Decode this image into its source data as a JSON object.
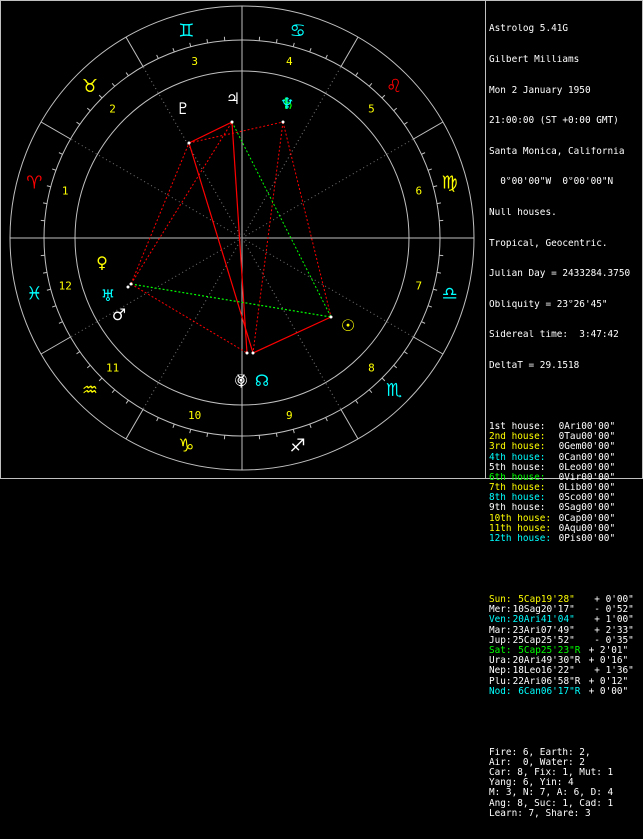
{
  "colors": {
    "background": "#000000",
    "circle": "#c0c0c0",
    "house_line": "#808080",
    "sign_fire": "#ff0000",
    "sign_earth": "#ffff00",
    "sign_air": "#00ffff",
    "sign_water": "#00ffff",
    "aspect_square": "#ff0000",
    "aspect_trine": "#00ff00",
    "house_number": "#ffff00"
  },
  "header": {
    "program": "Astrolog 5.41G",
    "name": "Gilbert Milliams",
    "date": "Mon 2 January 1950",
    "time": "21:00:00 (ST +0:00 GMT)",
    "place": "Santa Monica, California",
    "coords": "  0°00'00\"W  0°00'00\"N",
    "houses": "Null houses.",
    "zodiac": "Tropical, Geocentric.",
    "julian": "Julian Day = 2433284.3750",
    "obliquity": "Obliquity = 23°26'45\"",
    "sidereal": "Sidereal time:  3:47:42",
    "deltat": "DeltaT = 29.1518"
  },
  "cusps": [
    {
      "house": "1st house:",
      "pos": " 0Ari00'00\"",
      "color": "#ffffff"
    },
    {
      "house": "2nd house:",
      "pos": " 0Tau00'00\"",
      "color": "#ffff00"
    },
    {
      "house": "3rd house:",
      "pos": " 0Gem00'00\"",
      "color": "#ffff00"
    },
    {
      "house": "4th house:",
      "pos": " 0Can00'00\"",
      "color": "#00ffff"
    },
    {
      "house": "5th house:",
      "pos": " 0Leo00'00\"",
      "color": "#ffffff"
    },
    {
      "house": "6th house:",
      "pos": " 0Vir00'00\"",
      "color": "#00ff00"
    },
    {
      "house": "7th house:",
      "pos": " 0Lib00'00\"",
      "color": "#ffff00"
    },
    {
      "house": "8th house:",
      "pos": " 0Sco00'00\"",
      "color": "#00ffff"
    },
    {
      "house": "9th house:",
      "pos": " 0Sag00'00\"",
      "color": "#ffffff"
    },
    {
      "house": "10th house:",
      "pos": " 0Cap00'00\"",
      "color": "#ffff00"
    },
    {
      "house": "11th house:",
      "pos": " 0Aqu00'00\"",
      "color": "#ffff00"
    },
    {
      "house": "12th house:",
      "pos": " 0Pis00'00\"",
      "color": "#00ffff"
    }
  ],
  "planets": [
    {
      "name": "Sun:",
      "pos": "  5Cap19'28\"",
      "speed": "  + 0'00\"",
      "color": "#ffff00"
    },
    {
      "name": "Mer:",
      "pos": " 10Sag20'17\"",
      "speed": "  - 0'52\"",
      "color": "#ffffff"
    },
    {
      "name": "Ven:",
      "pos": " 20Ari41'04\"",
      "speed": "  + 1'00\"",
      "color": "#00ffff"
    },
    {
      "name": "Mar:",
      "pos": " 23Ari07'49\"",
      "speed": "  + 2'33\"",
      "color": "#ffffff"
    },
    {
      "name": "Jup:",
      "pos": " 25Cap25'52\"",
      "speed": "  - 0'35\"",
      "color": "#ffffff"
    },
    {
      "name": "Sat:",
      "pos": "  5Cap25'23\"R",
      "speed": " + 2'01\"",
      "color": "#00ff00"
    },
    {
      "name": "Ura:",
      "pos": " 20Ari49'30\"R",
      "speed": " + 0'16\"",
      "color": "#ffffff"
    },
    {
      "name": "Nep:",
      "pos": " 18Leo16'22\"",
      "speed": "  + 1'36\"",
      "color": "#ffffff"
    },
    {
      "name": "Plu:",
      "pos": " 22Ari06'58\"R",
      "speed": " + 0'12\"",
      "color": "#ffffff"
    },
    {
      "name": "Nod:",
      "pos": "  6Can06'17\"R",
      "speed": " + 0'00\"",
      "color": "#00ffff"
    }
  ],
  "summary": [
    "Fire: 6, Earth: 2,",
    "Air:  0, Water: 2",
    "Car: 8, Fix: 1, Mut: 1",
    "Yang: 6, Yin: 4",
    "M: 3, N: 7, A: 6, D: 4",
    "Ang: 8, Suc: 1, Cad: 1",
    "Learn: 7, Share: 3"
  ],
  "wheel": {
    "signs": [
      {
        "name": "aries",
        "glyph": "♈",
        "color": "#ff0000"
      },
      {
        "name": "taurus",
        "glyph": "♉",
        "color": "#ffff00"
      },
      {
        "name": "gemini",
        "glyph": "♊",
        "color": "#00ffff"
      },
      {
        "name": "cancer",
        "glyph": "♋",
        "color": "#00ffff"
      },
      {
        "name": "leo",
        "glyph": "♌",
        "color": "#ff0000"
      },
      {
        "name": "virgo",
        "glyph": "♍",
        "color": "#ffff00"
      },
      {
        "name": "libra",
        "glyph": "♎",
        "color": "#00ffff"
      },
      {
        "name": "scorpio",
        "glyph": "♏",
        "color": "#00ffff"
      },
      {
        "name": "sagittarius",
        "glyph": "♐",
        "color": "#ffffff"
      },
      {
        "name": "capricorn",
        "glyph": "♑",
        "color": "#ffff00"
      },
      {
        "name": "aquarius",
        "glyph": "♒",
        "color": "#ffff00"
      },
      {
        "name": "pisces",
        "glyph": "♓",
        "color": "#00ffff"
      }
    ],
    "house_numbers": [
      "1",
      "2",
      "3",
      "4",
      "5",
      "6",
      "7",
      "8",
      "9",
      "10",
      "11",
      "12"
    ],
    "planet_glyphs": [
      {
        "name": "venus",
        "glyph": "♀",
        "color": "#ffff00"
      },
      {
        "name": "uranus",
        "glyph": "♅",
        "color": "#00ffff"
      },
      {
        "name": "mars",
        "glyph": "♂",
        "color": "#ffffff"
      },
      {
        "name": "pluto",
        "glyph": "♇",
        "color": "#ffffff"
      },
      {
        "name": "jupiter",
        "glyph": "♃",
        "color": "#ffffff"
      },
      {
        "name": "saturn",
        "glyph": "♄",
        "color": "#00ff00"
      },
      {
        "name": "sun",
        "glyph": "☉",
        "color": "#ffff00"
      },
      {
        "name": "mercury",
        "glyph": "☿",
        "color": "#ffffff"
      },
      {
        "name": "neptune",
        "glyph": "♆",
        "color": "#00ffff"
      },
      {
        "name": "sun-lower",
        "glyph": "☉",
        "color": "#ffffff"
      },
      {
        "name": "node",
        "glyph": "☊",
        "color": "#00ffff"
      }
    ]
  }
}
